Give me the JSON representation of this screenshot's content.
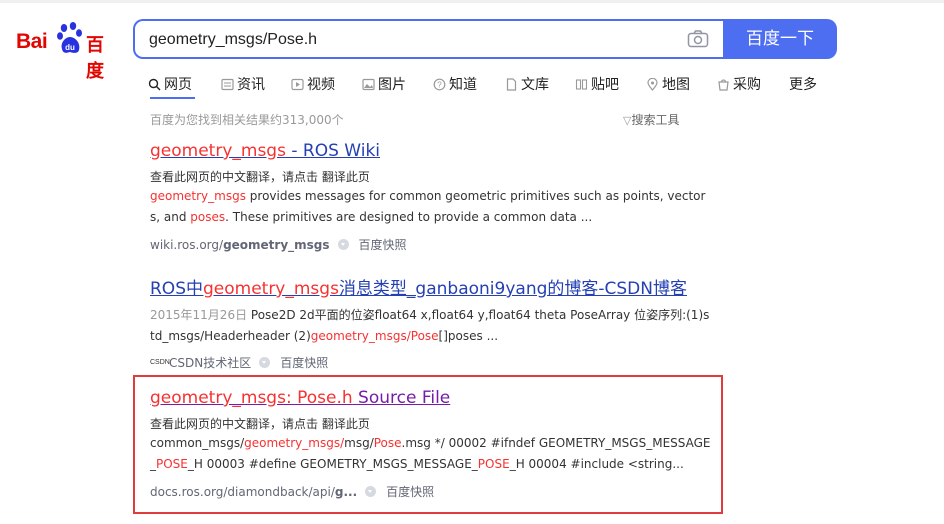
{
  "logo": {
    "part1": "Bai",
    "part2": "百度"
  },
  "search": {
    "query": "geometry_msgs/Pose.h",
    "button_label": "百度一下"
  },
  "tabs": [
    {
      "label": "网页",
      "icon": "search-icon",
      "active": true
    },
    {
      "label": "资讯",
      "icon": "news-icon"
    },
    {
      "label": "视频",
      "icon": "video-icon"
    },
    {
      "label": "图片",
      "icon": "image-icon"
    },
    {
      "label": "知道",
      "icon": "question-icon"
    },
    {
      "label": "文库",
      "icon": "doc-icon"
    },
    {
      "label": "贴吧",
      "icon": "tieba-icon"
    },
    {
      "label": "地图",
      "icon": "map-icon"
    },
    {
      "label": "采购",
      "icon": "shop-icon"
    },
    {
      "label": "更多",
      "icon": ""
    }
  ],
  "result_count": "百度为您找到相关结果约313,000个",
  "tools_label": "搜索工具",
  "results": [
    {
      "title_hl": "geometry_msgs",
      "title_rest": " - ROS Wiki",
      "translate": "查看此网页的中文翻译，请点击 翻译此页",
      "abs_hl1": "geometry_msgs",
      "abs_t1": " provides messages for common geometric primitives such as points, vectors, and ",
      "abs_hl2": "poses",
      "abs_t2": ". These primitives are designed to provide a common data ...",
      "source_domain": "wiki.ros.org/",
      "source_bold": "geometry_msgs",
      "snapshot": "百度快照"
    },
    {
      "title_a": "ROS中",
      "title_hl": "geometry_msgs",
      "title_b": "消息类型_ganbaoni9yang的博客-CSDN博客",
      "date": "2015年11月26日",
      "abs_t1": " Pose2D 2d平面的位姿float64 x,float64 y,float64 theta PoseArray 位姿序列:(1)std_msgs/Headerheader (2)",
      "abs_hl1": "geometry_msgs/Pose",
      "abs_t2": "[]poses ...",
      "source_icon_text": "CSDN",
      "source": "CSDN技术社区",
      "snapshot": "百度快照"
    },
    {
      "title_hl": "geometry_msgs: Pose.h",
      "title_rest": " Source File",
      "translate": "查看此网页的中文翻译，请点击 翻译此页",
      "abs_t1": "common_msgs/",
      "abs_hl1": "geometry_msgs/",
      "abs_t2": "msg/",
      "abs_hl2": "Pose",
      "abs_t3": ".msg */ 00002 #ifndef GEOMETRY_MSGS_MESSAGE_",
      "abs_hl3": "POSE",
      "abs_t4": "_H 00003 #define GEOMETRY_MSGS_MESSAGE_",
      "abs_hl4": "POSE",
      "abs_t5": "_H 00004 #include <string...",
      "source_domain": "docs.ros.org/diamondback/api/",
      "source_bold": "g...",
      "snapshot": "百度快照"
    }
  ]
}
